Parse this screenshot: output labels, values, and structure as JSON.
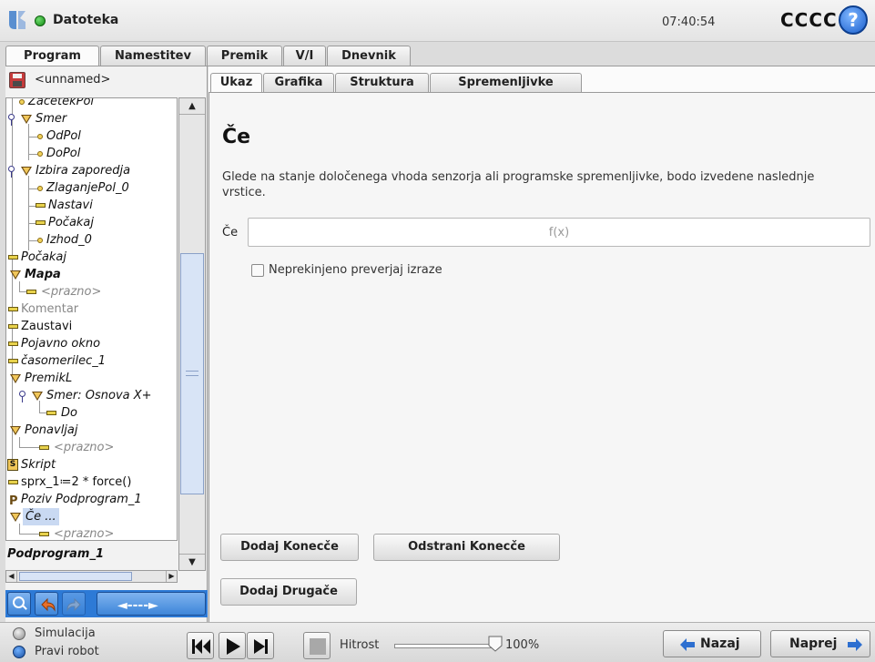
{
  "header": {
    "logo_text": "UR",
    "file_label": "Datoteka",
    "clock": "07:40:54",
    "robot_name": "CCCC",
    "help_label": "?"
  },
  "main_tabs": [
    {
      "label": "Program",
      "active": true
    },
    {
      "label": "Namestitev",
      "active": false
    },
    {
      "label": "Premik",
      "active": false
    },
    {
      "label": "V/I",
      "active": false
    },
    {
      "label": "Dnevnik",
      "active": false
    }
  ],
  "program": {
    "name": "<unnamed>"
  },
  "tree": {
    "rows": [
      {
        "label": "ZacetekPol",
        "icon": "waypoint-icon"
      },
      {
        "label": "Smer",
        "icon": "folder-icon"
      },
      {
        "label": "OdPol",
        "icon": "waypoint-icon"
      },
      {
        "label": "DoPol",
        "icon": "waypoint-icon"
      },
      {
        "label": "Izbira zaporedja",
        "icon": "folder-icon"
      },
      {
        "label": "ZlaganjePol_0",
        "icon": "waypoint-icon"
      },
      {
        "label": "Nastavi",
        "icon": "command-icon"
      },
      {
        "label": "Počakaj",
        "icon": "command-icon"
      },
      {
        "label": "Izhod_0",
        "icon": "waypoint-icon"
      },
      {
        "label": "Počakaj",
        "icon": "command-icon"
      },
      {
        "label": "Mapa",
        "icon": "folder-icon"
      },
      {
        "label": "<prazno>",
        "icon": "command-icon"
      },
      {
        "label": "Komentar",
        "icon": "command-icon"
      },
      {
        "label": "Zaustavi",
        "icon": "command-icon"
      },
      {
        "label": "Pojavno okno",
        "icon": "command-icon"
      },
      {
        "label": "časomerilec_1",
        "icon": "command-icon"
      },
      {
        "label": "PremikL",
        "icon": "folder-icon"
      },
      {
        "label": "Smer: Osnova X+",
        "icon": "folder-icon"
      },
      {
        "label": "Do",
        "icon": "command-icon"
      },
      {
        "label": "Ponavljaj",
        "icon": "folder-icon"
      },
      {
        "label": "<prazno>",
        "icon": "command-icon"
      },
      {
        "label": "Skript",
        "icon": "script-icon"
      },
      {
        "label": "sprx_1≔2 * force()",
        "icon": "command-icon"
      },
      {
        "label": "Poziv Podprogram_1",
        "icon": "call-icon"
      },
      {
        "label": "Če ...",
        "icon": "folder-icon"
      },
      {
        "label": "<prazno>",
        "icon": "command-icon"
      }
    ],
    "subprogram_label": "Podprogram_1",
    "move_arrows": "◄----►"
  },
  "sub_tabs": [
    {
      "label": "Ukaz",
      "active": true
    },
    {
      "label": "Grafika",
      "active": false
    },
    {
      "label": "Struktura",
      "active": false
    },
    {
      "label": "Spremenljivke",
      "active": false
    }
  ],
  "command": {
    "title": "Če",
    "description": "Glede na stanje določenega vhoda senzorja ali programske spremenljivke, bodo izvedene naslednje vrstice.",
    "if_label": "Če",
    "expression_placeholder": "f(x)",
    "continuous_check_label": "Neprekinjeno preverjaj izraze",
    "continuous_checked": false,
    "add_elseif": "Dodaj Konecče",
    "remove_elseif": "Odstrani Konecče",
    "add_else": "Dodaj Drugače"
  },
  "footer": {
    "simulation_label": "Simulacija",
    "real_robot_label": "Pravi robot",
    "speed_label": "Hitrost",
    "speed_value": "100%",
    "speed_fraction": 1.0,
    "back_label": "Nazaj",
    "next_label": "Naprej"
  },
  "colors": {
    "accent_blue": "#2d7ad6",
    "status_green": "#138a13",
    "tree_selection": "#c9d9f2"
  }
}
